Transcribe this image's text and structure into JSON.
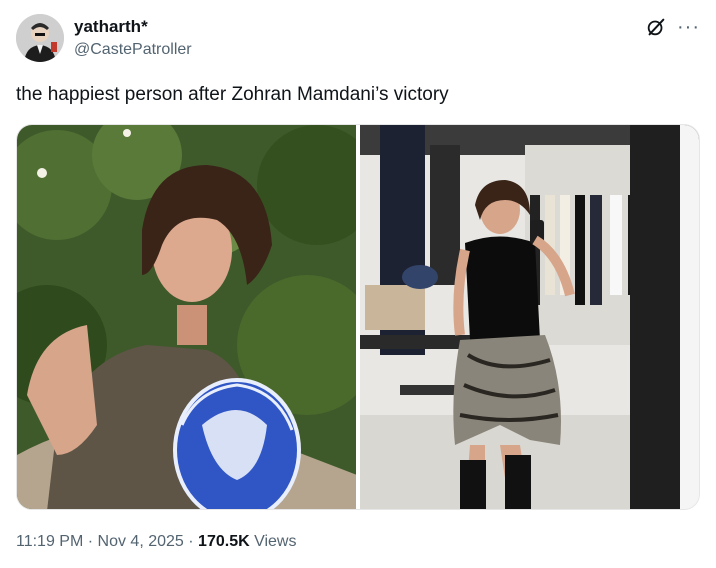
{
  "author": {
    "display_name": "yatharth*",
    "handle": "@CastePatroller",
    "avatar_icon": "avatar-photo"
  },
  "tweet": {
    "text": "the happiest person after Zohran Mamdani’s victory"
  },
  "icons": {
    "grok": "grok-icon",
    "more": "more-icon"
  },
  "media": {
    "count": 2
  },
  "meta": {
    "time": "11:19 PM",
    "separator": "·",
    "date": "Nov 4, 2025",
    "views_count": "170.5K",
    "views_label": "Views"
  }
}
